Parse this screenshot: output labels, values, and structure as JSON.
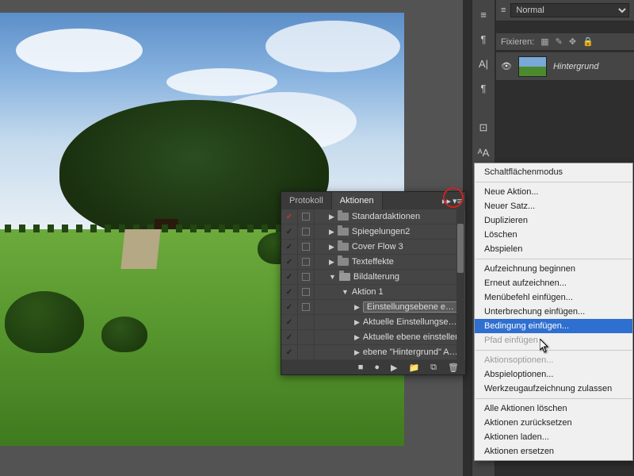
{
  "layers": {
    "blend_mode": "Normal",
    "lock_label": "Fixieren:",
    "layer_name": "Hintergrund"
  },
  "actions_panel": {
    "tabs": {
      "protocol": "Protokoll",
      "actions": "Aktionen"
    },
    "rows": [
      {
        "label": "Standardaktionen",
        "checked": true,
        "checkRed": true,
        "box": true,
        "kind": "folder",
        "indent": 0,
        "disc": "▶"
      },
      {
        "label": "Spiegelungen2",
        "checked": true,
        "checkRed": false,
        "box": true,
        "kind": "folder",
        "indent": 0,
        "disc": "▶"
      },
      {
        "label": "Cover Flow 3",
        "checked": true,
        "checkRed": false,
        "box": true,
        "kind": "folder",
        "indent": 0,
        "disc": "▶"
      },
      {
        "label": "Texteffekte",
        "checked": true,
        "checkRed": false,
        "box": true,
        "kind": "folder",
        "indent": 0,
        "disc": "▶"
      },
      {
        "label": "Bildalterung",
        "checked": true,
        "checkRed": false,
        "box": true,
        "kind": "folder-open",
        "indent": 0,
        "disc": "▼"
      },
      {
        "label": "Aktion 1",
        "checked": true,
        "checkRed": false,
        "box": true,
        "kind": "action",
        "indent": 1,
        "disc": "▼"
      },
      {
        "label": "Einstellungsebene erstell",
        "checked": true,
        "checkRed": false,
        "box": true,
        "kind": "step",
        "indent": 2,
        "disc": "▶",
        "selected": true,
        "trunc": true
      },
      {
        "label": "Aktuelle Einstellungsebe",
        "checked": true,
        "checkRed": false,
        "box": false,
        "kind": "step",
        "indent": 2,
        "disc": "▶",
        "trunc": true
      },
      {
        "label": "Aktuelle ebene einstellen",
        "checked": true,
        "checkRed": false,
        "box": false,
        "kind": "step",
        "indent": 2,
        "disc": "▶"
      },
      {
        "label": "ebene \"Hintergrund\" Aus",
        "checked": true,
        "checkRed": false,
        "box": false,
        "kind": "step",
        "indent": 2,
        "disc": "▶",
        "trunc": true
      }
    ],
    "footer_icons": [
      "■",
      "●",
      "▶",
      "📁",
      "⧉",
      "🗑"
    ]
  },
  "context_menu": {
    "groups": [
      [
        {
          "label": "Schaltflächenmodus"
        }
      ],
      [
        {
          "label": "Neue Aktion..."
        },
        {
          "label": "Neuer Satz..."
        },
        {
          "label": "Duplizieren"
        },
        {
          "label": "Löschen"
        },
        {
          "label": "Abspielen"
        }
      ],
      [
        {
          "label": "Aufzeichnung beginnen"
        },
        {
          "label": "Erneut aufzeichnen..."
        },
        {
          "label": "Menübefehl einfügen..."
        },
        {
          "label": "Unterbrechung einfügen..."
        },
        {
          "label": "Bedingung einfügen...",
          "highlighted": true
        },
        {
          "label": "Pfad einfügen",
          "disabled": true
        }
      ],
      [
        {
          "label": "Aktionsoptionen...",
          "disabled": true
        },
        {
          "label": "Abspieloptionen..."
        },
        {
          "label": "Werkzeugaufzeichnung zulassen"
        }
      ],
      [
        {
          "label": "Alle Aktionen löschen"
        },
        {
          "label": "Aktionen zurücksetzen"
        },
        {
          "label": "Aktionen laden..."
        },
        {
          "label": "Aktionen ersetzen"
        }
      ]
    ]
  },
  "tool_icons": [
    "≡",
    "¶",
    "A|",
    "¶",
    "⊡",
    "ᴬA",
    "▦"
  ]
}
